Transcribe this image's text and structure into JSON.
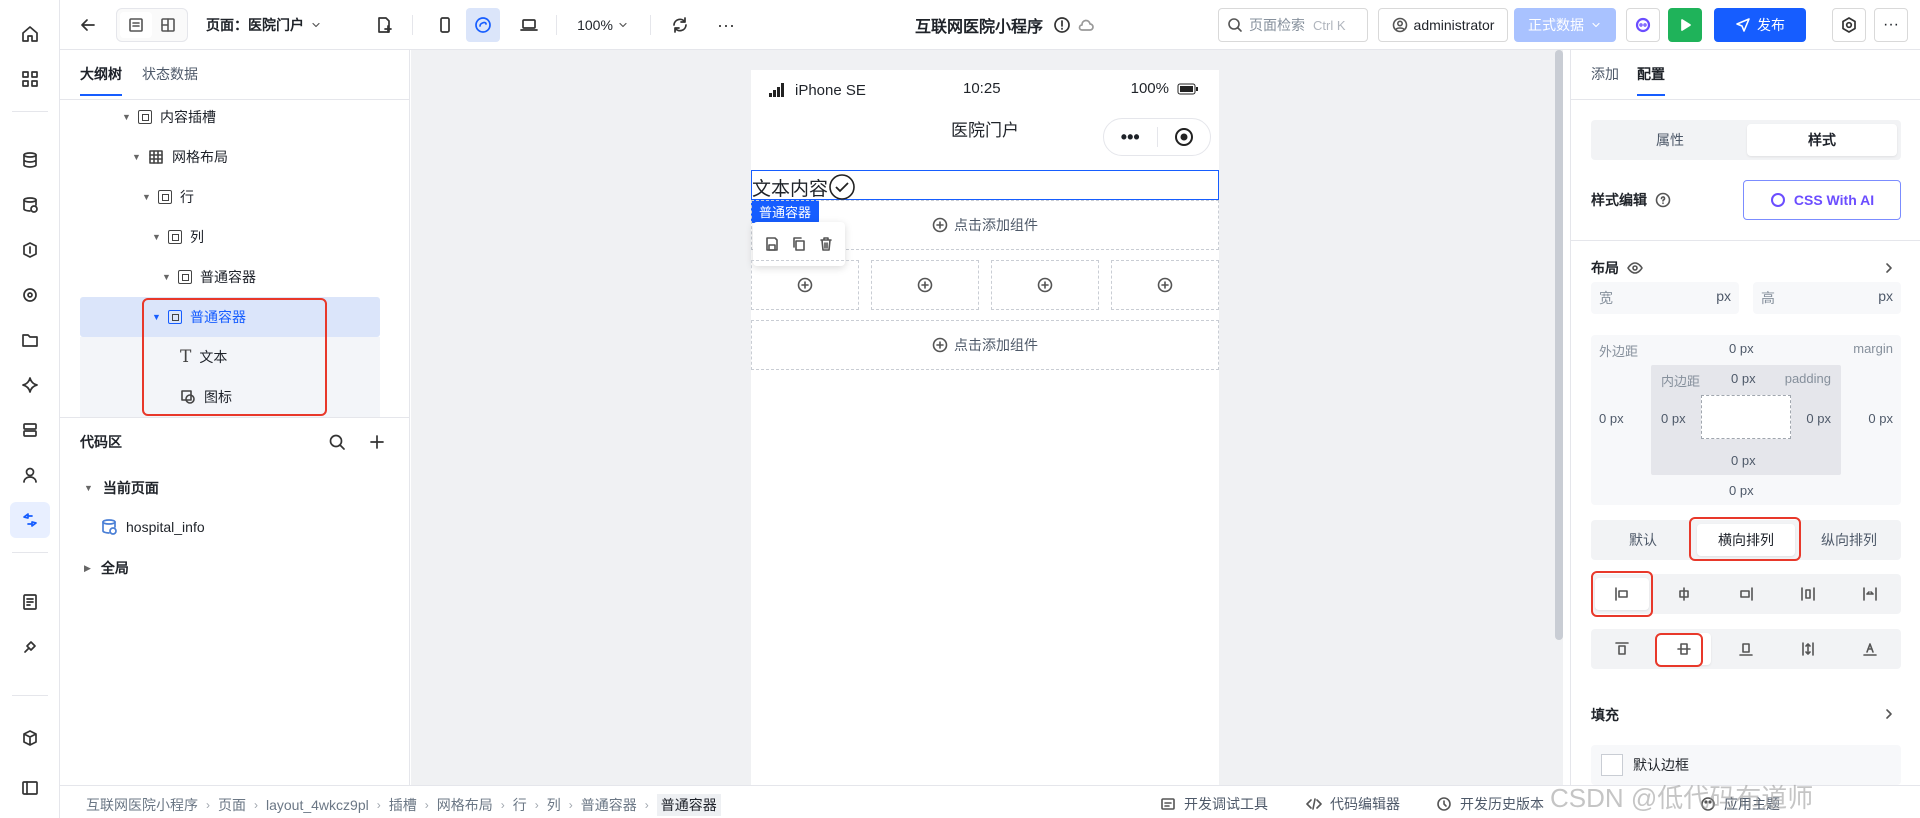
{
  "topbar": {
    "page_label": "页面：医院门户",
    "zoom": "100%",
    "title": "互联网医院小程序",
    "search_placeholder": "页面检索",
    "search_shortcut": "Ctrl K",
    "user": "administrator",
    "env": "正式数据",
    "publish": "发布"
  },
  "outline": {
    "tabs": [
      "大纲树",
      "状态数据"
    ],
    "nodes": [
      "内容插槽",
      "网格布局",
      "行",
      "列",
      "普通容器",
      "普通容器",
      "文本",
      "图标"
    ]
  },
  "code": {
    "title": "代码区",
    "current_page": "当前页面",
    "datasource": "hospital_info",
    "global": "全局"
  },
  "phone": {
    "device": "iPhone SE",
    "time": "10:25",
    "battery": "100%",
    "nav_title": "医院门户",
    "text_content": "文本内容",
    "tag": "普通容器",
    "add_component_1": "点击添加组件",
    "add_component_2": "点击添加组件"
  },
  "right": {
    "tabs": [
      "添加",
      "配置"
    ],
    "seg": [
      "属性",
      "样式"
    ],
    "style_edit": "样式编辑",
    "css_ai": "CSS With AI",
    "layout": "布局",
    "width_label": "宽",
    "height_label": "高",
    "unit": "px",
    "margin_label": "外边距",
    "margin_en": "margin",
    "padding_label": "内边距",
    "padding_en": "padding",
    "zero": "0 px",
    "direction": [
      "默认",
      "横向排列",
      "纵向排列"
    ],
    "fill": "填充",
    "default_border": "默认边框"
  },
  "status": {
    "crumbs": [
      "互联网医院小程序",
      "页面",
      "layout_4wkcz9pl",
      "插槽",
      "网格布局",
      "行",
      "列",
      "普通容器",
      "普通容器"
    ],
    "debug": "开发调试工具",
    "code_editor": "代码编辑器",
    "history": "开发历史版本",
    "theme": "应用主题",
    "watermark": "CSDN @低代码布道师"
  },
  "colors": {
    "accent": "#165dff",
    "highlight": "#e8382a",
    "green": "#1fb35a",
    "env_bg": "#a9c2ff"
  }
}
